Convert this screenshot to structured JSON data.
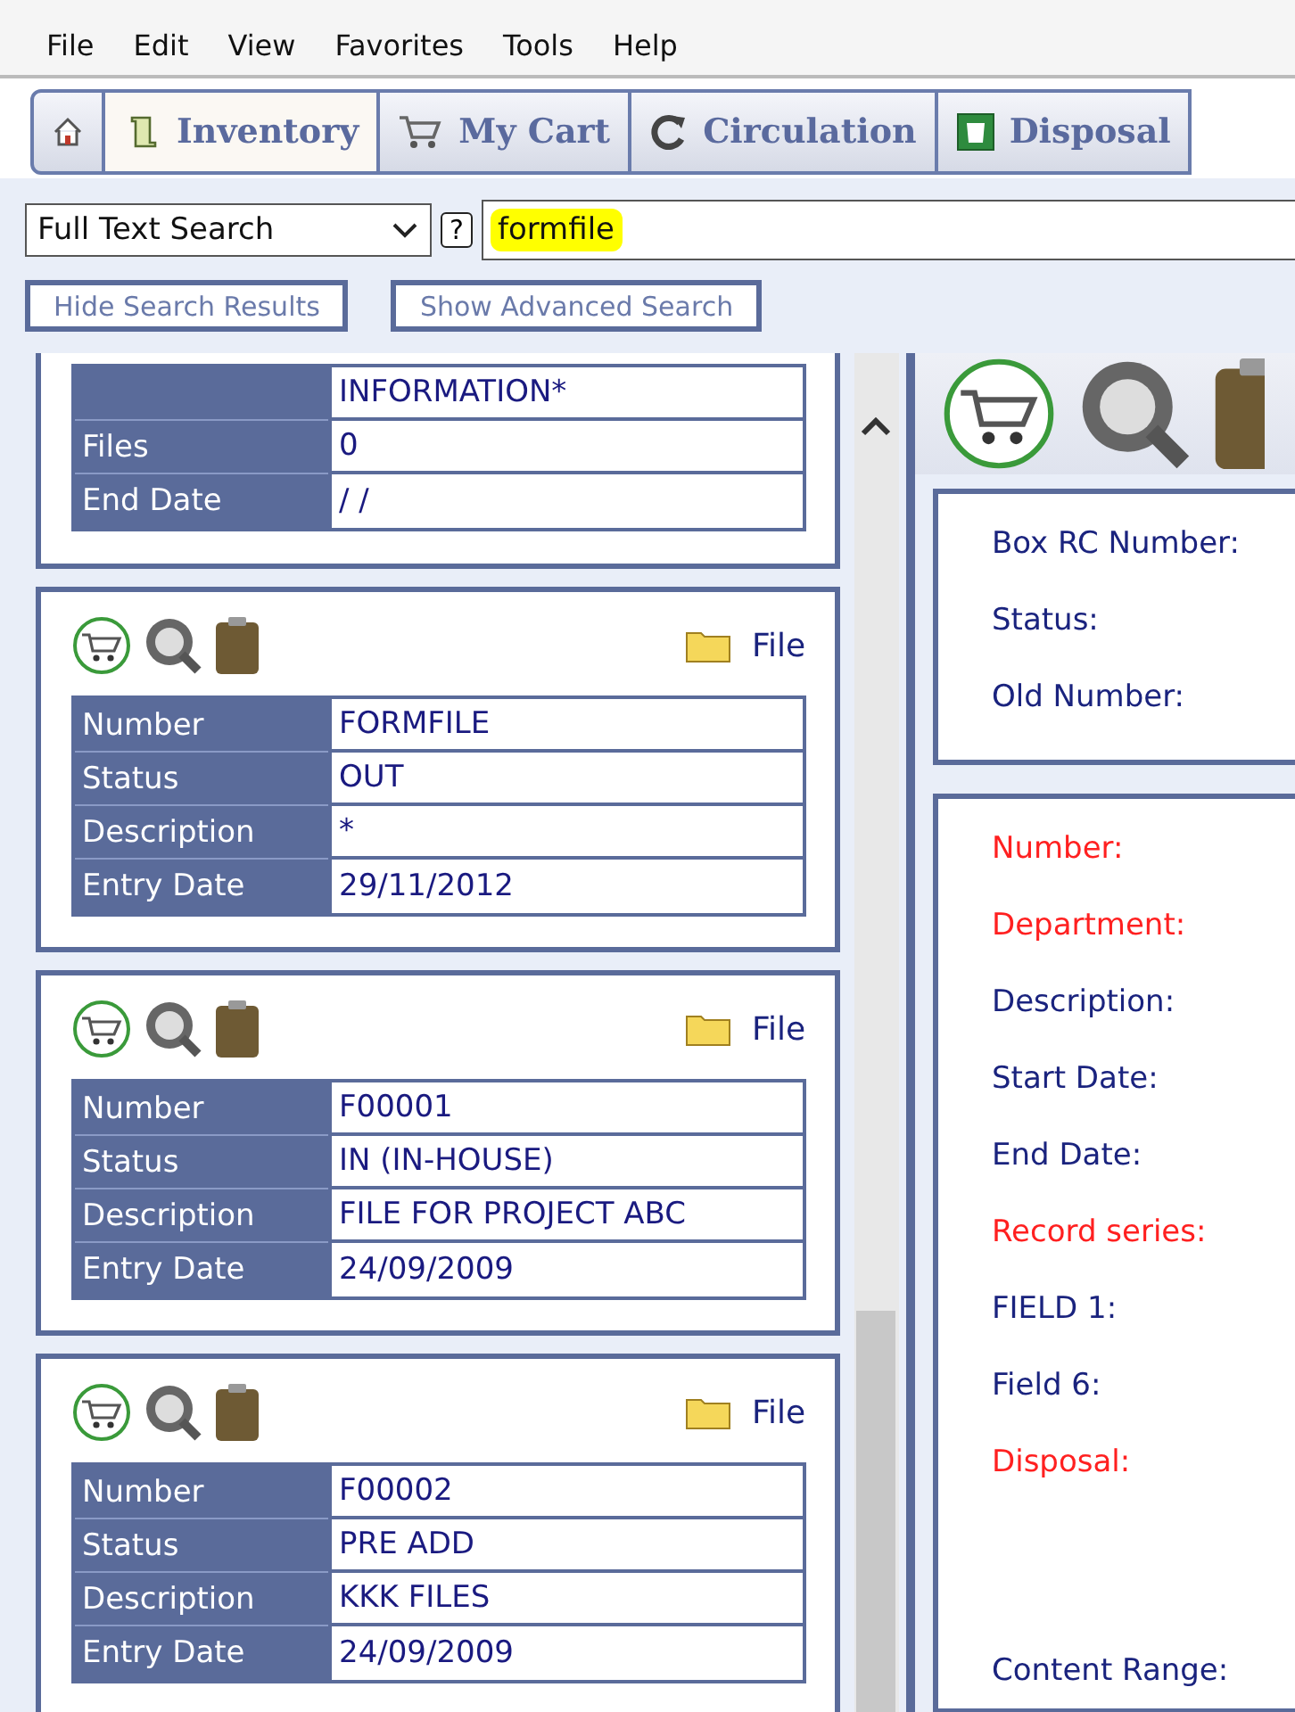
{
  "menu": [
    "File",
    "Edit",
    "View",
    "Favorites",
    "Tools",
    "Help"
  ],
  "tabs": [
    {
      "kind": "home",
      "selected": false
    },
    {
      "kind": "scroll",
      "label": "Inventory",
      "selected": true
    },
    {
      "kind": "cart",
      "label": "My Cart",
      "selected": false
    },
    {
      "kind": "refresh",
      "label": "Circulation",
      "selected": false
    },
    {
      "kind": "bin",
      "label": "Disposal",
      "selected": false
    }
  ],
  "search": {
    "mode": "Full Text Search",
    "help": "?",
    "value": "formfile"
  },
  "buttons": [
    "Hide Search Results",
    "Show Advanced Search"
  ],
  "partial_card": {
    "rows": [
      {
        "value": "INFORMATION*"
      },
      {
        "label": "Files",
        "value": "0"
      },
      {
        "label": "End Date",
        "value": "/ /"
      }
    ]
  },
  "cards": [
    {
      "type": "File",
      "rows": [
        {
          "label": "Number",
          "value": "FORMFILE"
        },
        {
          "label": "Status",
          "value": "OUT"
        },
        {
          "label": "Description",
          "value": "*"
        },
        {
          "label": "Entry Date",
          "value": "29/11/2012"
        }
      ]
    },
    {
      "type": "File",
      "rows": [
        {
          "label": "Number",
          "value": "F00001"
        },
        {
          "label": "Status",
          "value": "IN (IN-HOUSE)"
        },
        {
          "label": "Description",
          "value": "FILE FOR PROJECT ABC"
        },
        {
          "label": "Entry Date",
          "value": "24/09/2009"
        }
      ]
    },
    {
      "type": "File",
      "rows": [
        {
          "label": "Number",
          "value": "F00002"
        },
        {
          "label": "Status",
          "value": "PRE ADD"
        },
        {
          "label": "Description",
          "value": "KKK FILES"
        },
        {
          "label": "Entry Date",
          "value": "24/09/2009"
        }
      ]
    }
  ],
  "box_section": [
    "Box RC Number:",
    "Status:",
    "Old Number:"
  ],
  "detail_fields": [
    {
      "label": "Number:",
      "required": true
    },
    {
      "label": "Department:",
      "required": true
    },
    {
      "label": "Description:",
      "required": false
    },
    {
      "label": "Start Date:",
      "required": false
    },
    {
      "label": "End Date:",
      "required": false
    },
    {
      "label": "Record series:",
      "required": true
    },
    {
      "label": "FIELD 1:",
      "required": false
    },
    {
      "label": "Field 6:",
      "required": false
    },
    {
      "label": "Disposal:",
      "required": true
    }
  ],
  "footer_field": {
    "label": "Content Range:"
  }
}
